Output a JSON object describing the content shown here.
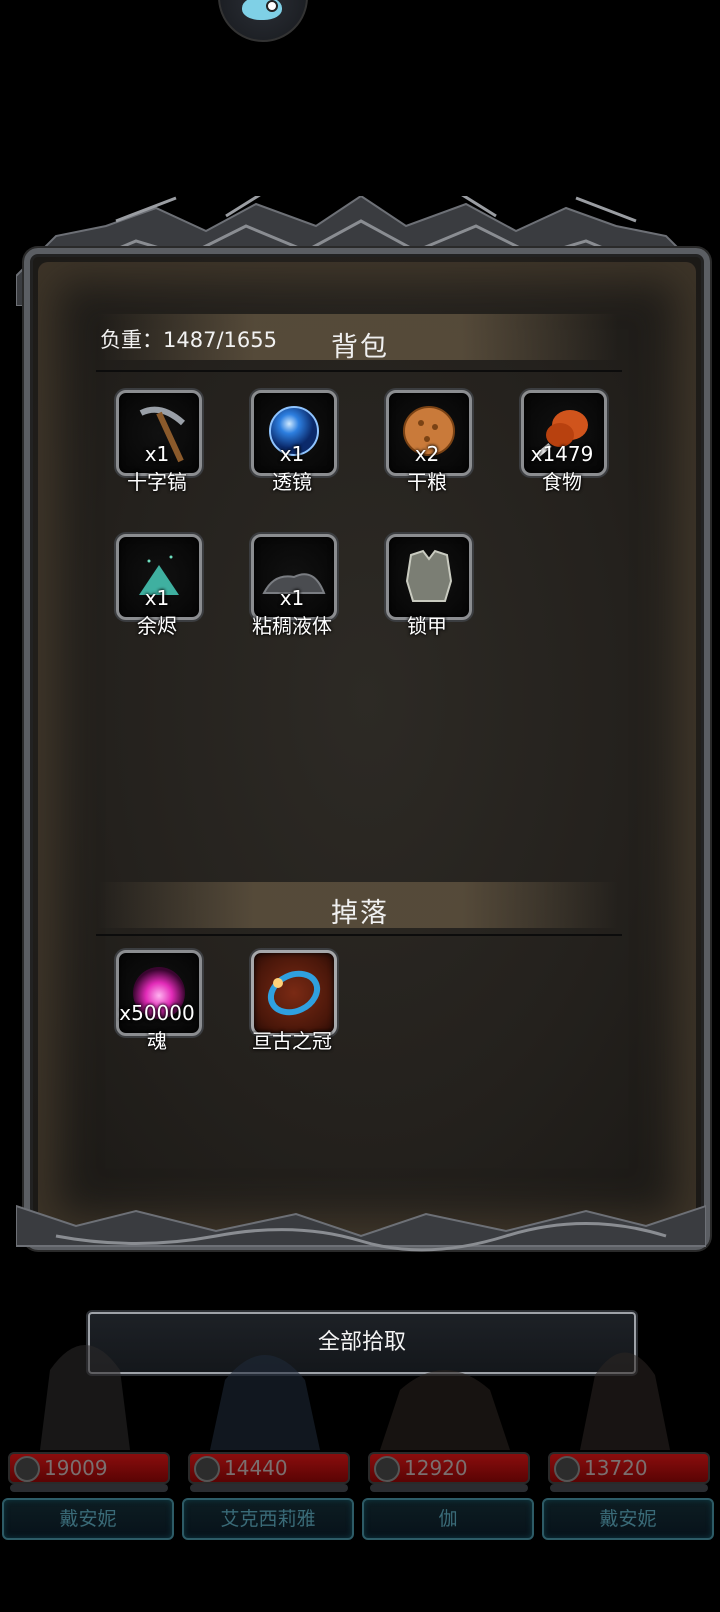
{
  "header": {
    "weight_label": "负重：1487/1655",
    "bag_title": "背包",
    "drop_title": "掉落"
  },
  "bag_items": [
    {
      "name": "十字镐",
      "qty": "x1",
      "icon": "pickaxe-icon"
    },
    {
      "name": "透镜",
      "qty": "x1",
      "icon": "lens-icon"
    },
    {
      "name": "干粮",
      "qty": "x2",
      "icon": "biscuit-icon"
    },
    {
      "name": "食物",
      "qty": "x1479",
      "icon": "meat-icon"
    },
    {
      "name": "余烬",
      "qty": "x1",
      "icon": "ember-icon"
    },
    {
      "name": "粘稠液体",
      "qty": "x1",
      "icon": "slime-icon"
    },
    {
      "name": "锁甲",
      "qty": "",
      "icon": "chainmail-icon"
    }
  ],
  "drop_items": [
    {
      "name": "魂",
      "qty": "x50000",
      "icon": "soul-icon"
    },
    {
      "name": "亘古之冠",
      "qty": "",
      "icon": "crown-icon"
    }
  ],
  "pickup_button": "全部拾取",
  "party": [
    {
      "hp": "19009",
      "name": "戴安妮"
    },
    {
      "hp": "14440",
      "name": "艾克西莉雅"
    },
    {
      "hp": "12920",
      "name": "伽"
    },
    {
      "hp": "13720",
      "name": "戴安妮"
    }
  ],
  "colors": {
    "panel": "#24211d",
    "border": "#8b8d90",
    "hp_red": "#8a0d0d",
    "name_teal": "#2d5b66"
  }
}
